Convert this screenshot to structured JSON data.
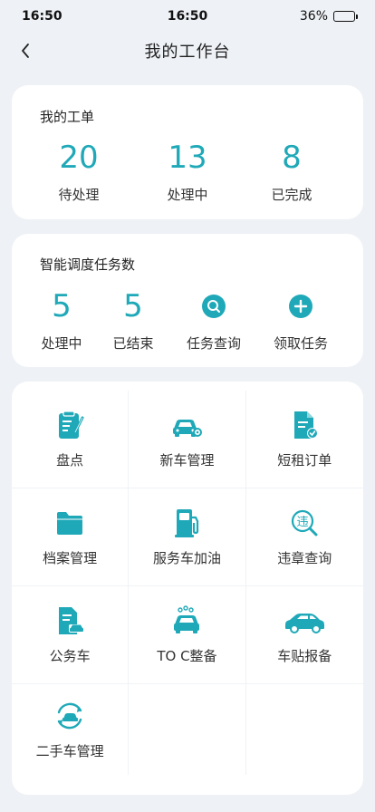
{
  "status_bar": {
    "time_left": "16:50",
    "time_center": "16:50",
    "battery": "36%",
    "battery_level": 0.36
  },
  "nav": {
    "title": "我的工作台"
  },
  "work_orders": {
    "title": "我的工单",
    "stats": [
      {
        "value": "20",
        "label": "待处理"
      },
      {
        "value": "13",
        "label": "处理中"
      },
      {
        "value": "8",
        "label": "已完成"
      }
    ]
  },
  "dispatch": {
    "title": "智能调度任务数",
    "stats": [
      {
        "value": "5",
        "label": "处理中"
      },
      {
        "value": "5",
        "label": "已结束"
      }
    ],
    "actions": [
      {
        "icon": "search-icon",
        "label": "任务查询"
      },
      {
        "icon": "plus-icon",
        "label": "领取任务"
      }
    ]
  },
  "features": {
    "accent": "#1fa9b8",
    "items": [
      {
        "icon": "clipboard-edit-icon",
        "label": "盘点"
      },
      {
        "icon": "car-gear-icon",
        "label": "新车管理"
      },
      {
        "icon": "document-check-icon",
        "label": "短租订单"
      },
      {
        "icon": "folder-icon",
        "label": "档案管理"
      },
      {
        "icon": "fuel-pump-icon",
        "label": "服务车加油"
      },
      {
        "icon": "violation-search-icon",
        "label": "违章查询"
      },
      {
        "icon": "document-car-icon",
        "label": "公务车"
      },
      {
        "icon": "car-wash-icon",
        "label": "TO C整备"
      },
      {
        "icon": "car-side-icon",
        "label": "车贴报备"
      },
      {
        "icon": "car-cycle-icon",
        "label": "二手车管理"
      }
    ]
  }
}
